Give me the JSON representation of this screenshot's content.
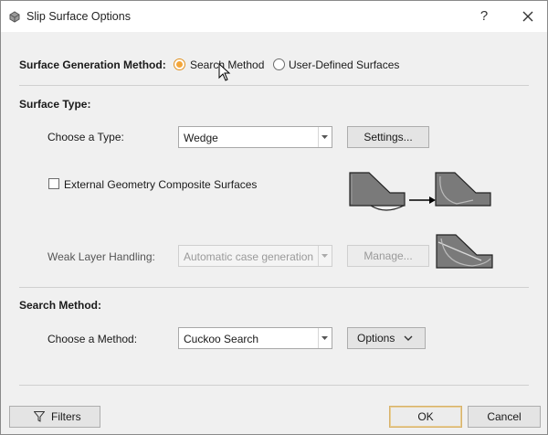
{
  "window": {
    "title": "Slip Surface Options",
    "help_label": "?"
  },
  "surface_generation": {
    "label": "Surface Generation Method:",
    "options": [
      {
        "label": "Search Method",
        "checked": true
      },
      {
        "label": "User-Defined Surfaces",
        "checked": false
      }
    ]
  },
  "surface_type": {
    "heading": "Surface Type:",
    "choose_label": "Choose a Type:",
    "type_value": "Wedge",
    "settings_label": "Settings...",
    "composite_label": "External Geometry Composite Surfaces",
    "composite_checked": false,
    "weak_layer_label": "Weak Layer Handling:",
    "weak_layer_value": "Automatic case generation",
    "manage_label": "Manage..."
  },
  "search_method": {
    "heading": "Search Method:",
    "choose_label": "Choose a Method:",
    "method_value": "Cuckoo Search",
    "options_label": "Options"
  },
  "footer": {
    "filters_label": "Filters",
    "ok_label": "OK",
    "cancel_label": "Cancel"
  },
  "colors": {
    "accent": "#f3a63a",
    "default_border": "#d8b26a",
    "slope_fill": "#7a7a7a"
  }
}
